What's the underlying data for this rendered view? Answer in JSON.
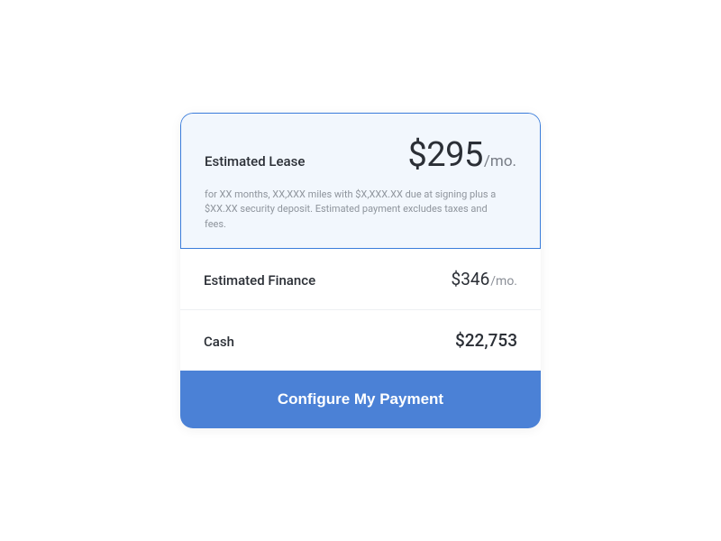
{
  "options": {
    "lease": {
      "label": "Estimated Lease",
      "price": "$295",
      "suffix": "/mo.",
      "fineprint": "for XX months, XX,XXX miles with $X,XXX.XX due at signing plus a $XX.XX security deposit. Estimated payment excludes taxes and fees."
    },
    "finance": {
      "label": "Estimated Finance",
      "price": "$346",
      "suffix": "/mo."
    },
    "cash": {
      "label": "Cash",
      "price": "$22,753"
    }
  },
  "cta": {
    "label": "Configure My Payment"
  }
}
